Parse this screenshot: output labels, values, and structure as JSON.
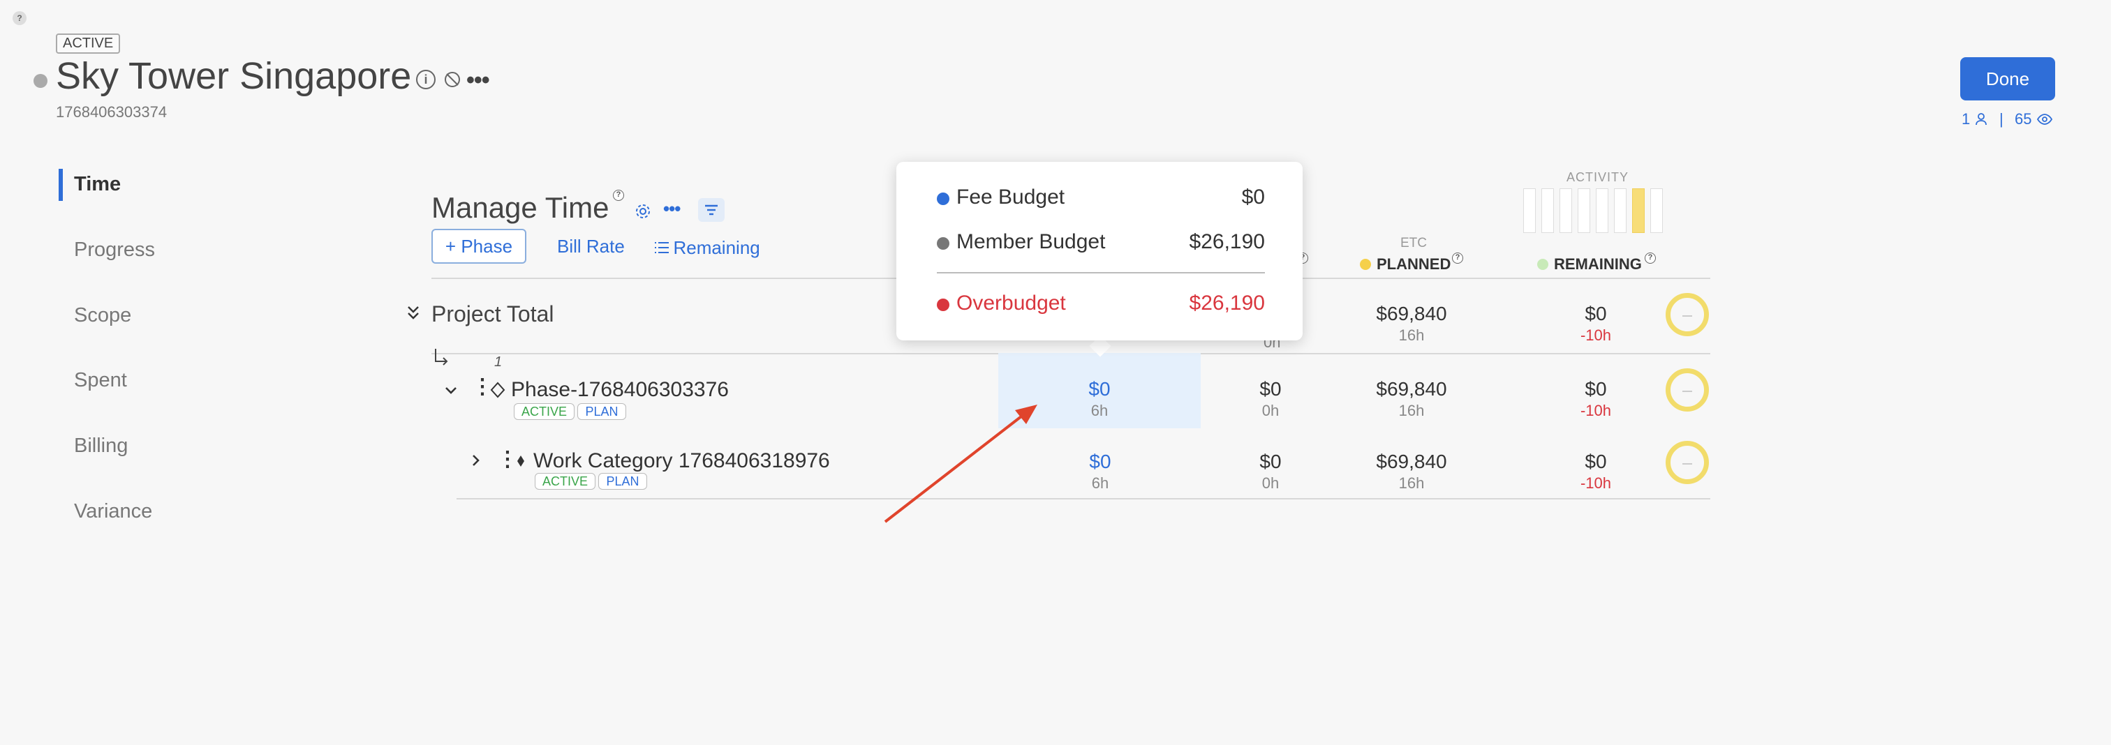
{
  "header": {
    "help_glyph": "?",
    "status_tag": "ACTIVE",
    "project_title": "Sky Tower Singapore",
    "project_id": "1768406303374",
    "done_label": "Done",
    "members_count": "1",
    "separator": "|",
    "views_count": "65"
  },
  "sidebar": {
    "items": [
      {
        "label": "Time"
      },
      {
        "label": "Progress"
      },
      {
        "label": "Scope"
      },
      {
        "label": "Spent"
      },
      {
        "label": "Billing"
      },
      {
        "label": "Variance"
      }
    ]
  },
  "manage": {
    "title": "Manage Time",
    "add_phase_label": "+ Phase",
    "bill_rate_label": "Bill Rate",
    "remaining_label": "Remaining"
  },
  "columns": {
    "activity_label": "ACTIVITY",
    "etc_label": "ETC",
    "planned_label": "PLANNED",
    "remaining_label": "REMAINING",
    "planned_dot_color": "#f5d04a",
    "remaining_dot_color": "#c8eab8"
  },
  "tooltip": {
    "fee_budget_label": "Fee Budget",
    "fee_budget_value": "$0",
    "fee_budget_color": "#2f6ed8",
    "member_budget_label": "Member Budget",
    "member_budget_value": "$26,190",
    "member_budget_color": "#777777",
    "overbudget_label": "Overbudget",
    "overbudget_value": "$26,190",
    "overbudget_color": "#d9363e"
  },
  "project_total": {
    "label": "Project Total",
    "hidden_hours": "0h",
    "planned_value": "$69,840",
    "planned_hours": "16h",
    "remaining_value": "$0",
    "remaining_hours": "-10h"
  },
  "phase": {
    "index": "1",
    "name": "Phase-1768406303376",
    "badge_active": "ACTIVE",
    "badge_plan": "PLAN",
    "budget_value": "$0",
    "budget_hours": "6h",
    "spent_value": "$0",
    "spent_hours": "0h",
    "planned_value": "$69,840",
    "planned_hours": "16h",
    "remaining_value": "$0",
    "remaining_hours": "-10h"
  },
  "work_category": {
    "name": "Work Category 1768406318976",
    "badge_active": "ACTIVE",
    "badge_plan": "PLAN",
    "budget_value": "$0",
    "budget_hours": "6h",
    "spent_value": "$0",
    "spent_hours": "0h",
    "planned_value": "$69,840",
    "planned_hours": "16h",
    "remaining_value": "$0",
    "remaining_hours": "-10h"
  },
  "activity_bars": {
    "count": 8,
    "filled_index": 6
  },
  "annotation_arrow_color": "#e0442c"
}
